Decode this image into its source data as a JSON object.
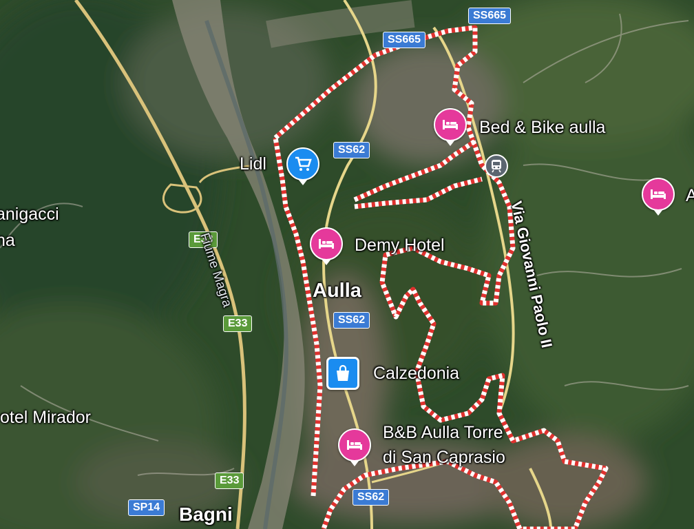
{
  "colors": {
    "motorway": "#d9c27a",
    "boundary_red": "#e0322f",
    "boundary_white": "#ffffff",
    "shield_blue": "#3b7bd4",
    "shield_green": "#5a9a3a",
    "hotel_pin": "#e5399b",
    "poi_blue": "#1a8cf0",
    "rail_badge": "#5b6670"
  },
  "roads": {
    "ss665_a": "SS665",
    "ss665_b": "SS665",
    "ss62_a": "SS62",
    "ss62_b": "SS62",
    "ss62_c": "SS62",
    "e33_a": "E33",
    "e33_b": "E33",
    "e33_c": "E33",
    "sp14": "SP14"
  },
  "places": {
    "lidl": "Lidl",
    "bed_bike": "Bed & Bike aulla",
    "demy_hotel": "Demy Hotel",
    "aulla": "Aulla",
    "calzedonia": "Calzedonia",
    "bb_torre_line1": "B&B Aulla Torre",
    "bb_torre_line2": "di San Caprasio",
    "river": "Fiume Magra",
    "via_giovanni": "Via Giovanni Paolo II",
    "hotel_mirador": "otel Mirador",
    "nigacci_line1": "anigacci",
    "nigacci_line2": "na",
    "bagni": "Bagni",
    "right_edge": "A"
  },
  "icons": {
    "hotel": "bed-icon",
    "shopping_cart": "shopping-cart-icon",
    "shopping_bag": "shopping-bag-icon",
    "train": "train-station-icon"
  }
}
